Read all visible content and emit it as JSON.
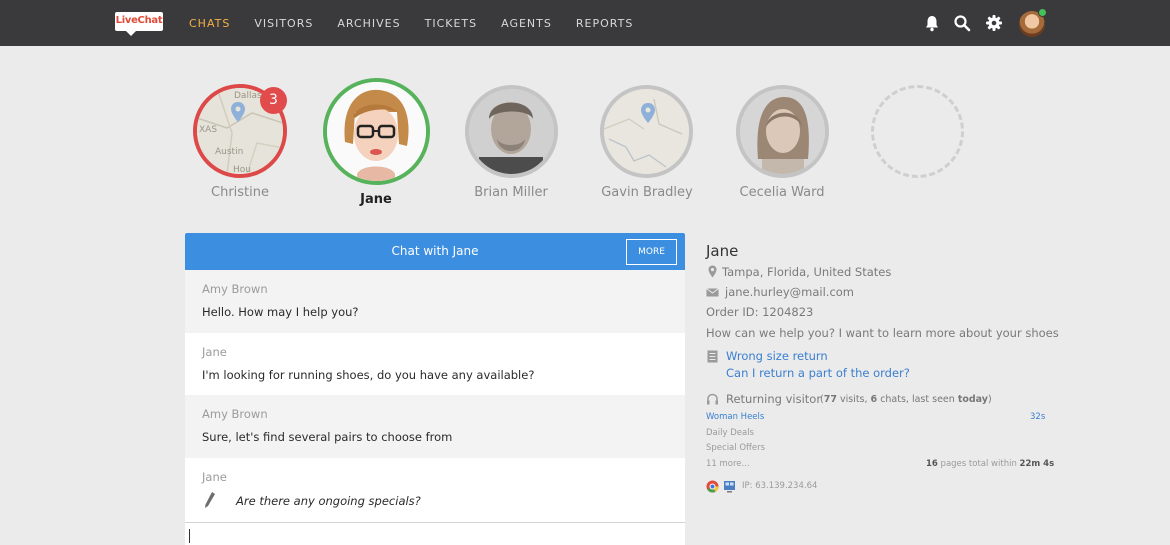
{
  "app": {
    "logo_text": "LiveChat",
    "nav": [
      "CHATS",
      "VISITORS",
      "ARCHIVES",
      "TICKETS",
      "AGENTS",
      "REPORTS"
    ],
    "active_nav": "CHATS"
  },
  "chats": [
    {
      "name": "Christine",
      "badge": "3",
      "kind": "map",
      "labels": [
        "Dallas",
        "XAS",
        "Austin",
        "Hou"
      ]
    },
    {
      "name": "Jane",
      "active": true,
      "kind": "photo"
    },
    {
      "name": "Brian Miller",
      "kind": "photo"
    },
    {
      "name": "Gavin Bradley",
      "kind": "map"
    },
    {
      "name": "Cecelia Ward",
      "kind": "photo"
    },
    {
      "name": "",
      "kind": "empty"
    }
  ],
  "chat_panel": {
    "title": "Chat with Jane",
    "more_label": "MORE",
    "messages": [
      {
        "author": "Amy Brown",
        "text": "Hello. How may I help you?"
      },
      {
        "author": "Jane",
        "text": "I'm looking for running shoes, do you have any available?"
      },
      {
        "author": "Amy Brown",
        "text": "Sure, let's find several pairs to choose from"
      },
      {
        "author": "Jane",
        "text": "Are there any ongoing specials?"
      }
    ]
  },
  "visitor": {
    "name": "Jane",
    "location": "Tampa, Florida, United States",
    "email": "jane.hurley@mail.com",
    "order": "Order ID: 1204823",
    "question": "How can we help you? I want to learn more about your shoes",
    "tickets": [
      "Wrong size return",
      "Can I return a part of the order?"
    ],
    "returning_label": "Returning visitor",
    "visits": "77",
    "chats": "6",
    "last_seen": "today",
    "pages": [
      "Woman Heels",
      "Daily Deals",
      "Special Offers",
      "11 more..."
    ],
    "page_time": "32s",
    "pages_count": "16",
    "total_time": "22m 4s",
    "ip": "IP: 63.139.234.64"
  },
  "colors": {
    "topbar": "#3a393c",
    "accent": "#f6b149",
    "chat_header": "#3b8ee0",
    "badge": "#e14b4b",
    "active_ring": "#57b35b",
    "alert_ring": "#dd4848",
    "link": "#3a7fd0"
  }
}
